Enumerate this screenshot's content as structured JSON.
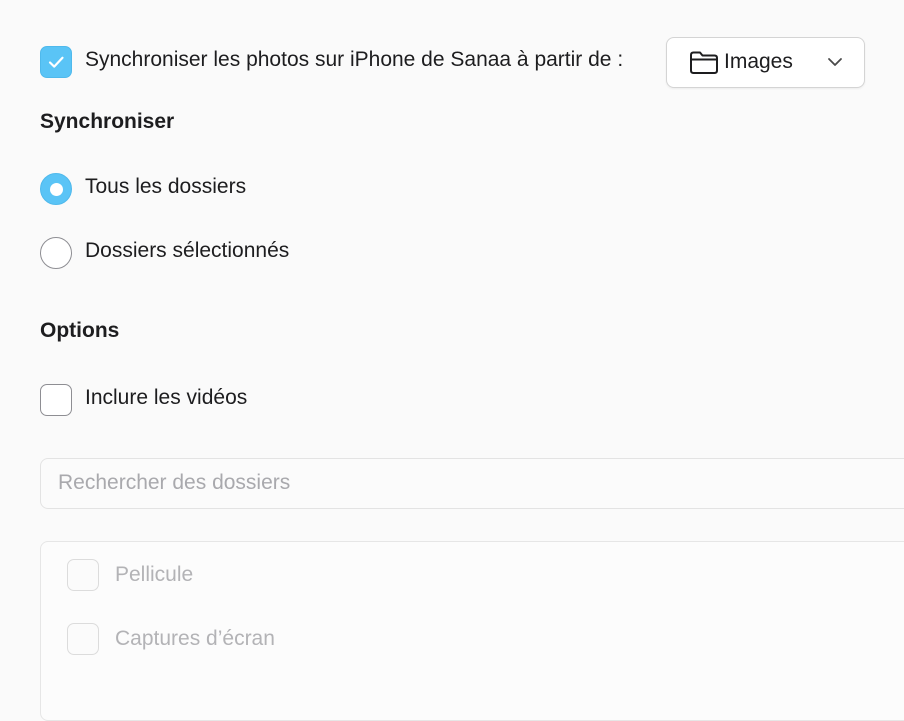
{
  "sync": {
    "checkbox_checked": true,
    "label": "Synchroniser les photos sur iPhone de Sanaa à partir de :",
    "source": {
      "selected": "Images",
      "icon": "folder-icon",
      "caret": "chevron-down-icon"
    }
  },
  "sync_section": {
    "heading": "Synchroniser",
    "options": [
      {
        "label": "Tous les dossiers",
        "selected": true
      },
      {
        "label": "Dossiers sélectionnés",
        "selected": false
      }
    ]
  },
  "options_section": {
    "heading": "Options",
    "include_videos": {
      "label": "Inclure les vidéos",
      "checked": false
    }
  },
  "folders": {
    "search_placeholder": "Rechercher des dossiers",
    "items": [
      {
        "label": "Pellicule",
        "checked": false
      },
      {
        "label": "Captures d’écran",
        "checked": false
      }
    ]
  },
  "colors": {
    "accent": "#5ac4f6",
    "text": "#1d1d1f",
    "disabled_text": "#b3b3b6",
    "background": "#fafafa"
  }
}
